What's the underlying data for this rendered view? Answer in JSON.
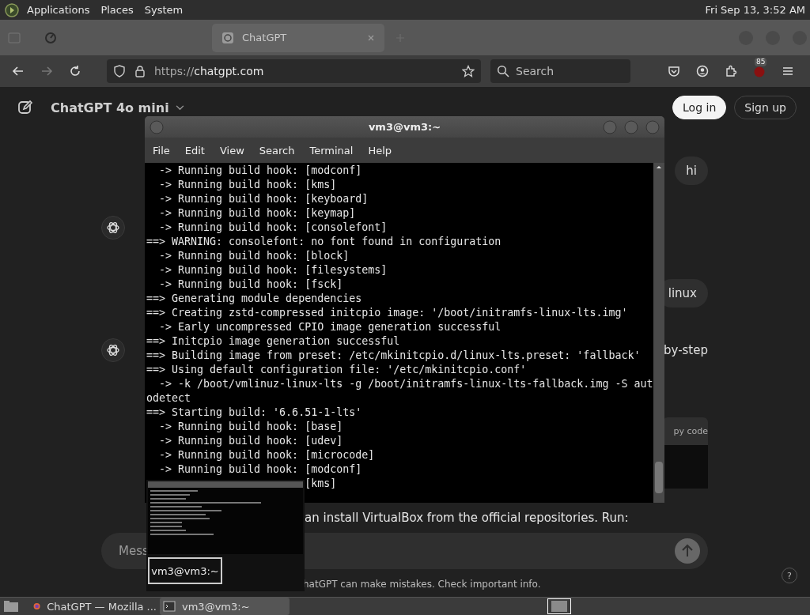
{
  "top_panel": {
    "menus": [
      "Applications",
      "Places",
      "System"
    ],
    "clock": "Fri Sep 13,  3:52 AM"
  },
  "browser": {
    "tabs": [
      {
        "kind": "blurred",
        "selected": false
      },
      {
        "kind": "page",
        "title": "ChatGPT",
        "selected": true
      }
    ],
    "url": {
      "scheme": "https://",
      "host": "chatgpt.com"
    },
    "search": {
      "placeholder": "Search"
    },
    "extension_badge": "85"
  },
  "chat": {
    "model": "ChatGPT 4o mini",
    "buttons": [
      "Log in",
      "Sign up"
    ],
    "messages": [
      {
        "kind": "user",
        "text": "hi"
      },
      {
        "kind": "assistant"
      },
      {
        "kind": "user",
        "text": "linux"
      },
      {
        "kind": "assistant",
        "text": "by-step"
      },
      {
        "kind": "code",
        "text": "py code"
      },
      {
        "kind": "text",
        "text": "an install VirtualBox from the official repositories. Run:"
      }
    ],
    "input": {
      "placeholder": "Mess"
    },
    "disclaimer": "hatGPT can make mistakes. Check important info.",
    "help": "?"
  },
  "terminal": {
    "title": "vm3@vm3:~",
    "menu": [
      "File",
      "Edit",
      "View",
      "Search",
      "Terminal",
      "Help"
    ],
    "lines": [
      "  -> Running build hook: [modconf]",
      "  -> Running build hook: [kms]",
      "  -> Running build hook: [keyboard]",
      "  -> Running build hook: [keymap]",
      "  -> Running build hook: [consolefont]",
      "==> WARNING: consolefont: no font found in configuration",
      "  -> Running build hook: [block]",
      "  -> Running build hook: [filesystems]",
      "  -> Running build hook: [fsck]",
      "==> Generating module dependencies",
      "==> Creating zstd-compressed initcpio image: '/boot/initramfs-linux-lts.img'",
      "  -> Early uncompressed CPIO image generation successful",
      "==> Initcpio image generation successful",
      "==> Building image from preset: /etc/mkinitcpio.d/linux-lts.preset: 'fallback'",
      "==> Using default configuration file: '/etc/mkinitcpio.conf'",
      "  -> -k /boot/vmlinuz-linux-lts -g /boot/initramfs-linux-lts-fallback.img -S aut",
      "odetect",
      "==> Starting build: '6.6.51-1-lts'",
      "  -> Running build hook: [base]",
      "  -> Running build hook: [udev]",
      "  -> Running build hook: [microcode]",
      "  -> Running build hook: [modconf]",
      "                         [kms]"
    ]
  },
  "preview": {
    "label": "vm3@vm3:~"
  },
  "taskbar": {
    "items": [
      {
        "kind": "firefox",
        "label": "ChatGPT — Mozilla ...",
        "selected": false
      },
      {
        "kind": "terminal",
        "label": "vm3@vm3:~",
        "selected": true
      }
    ]
  }
}
